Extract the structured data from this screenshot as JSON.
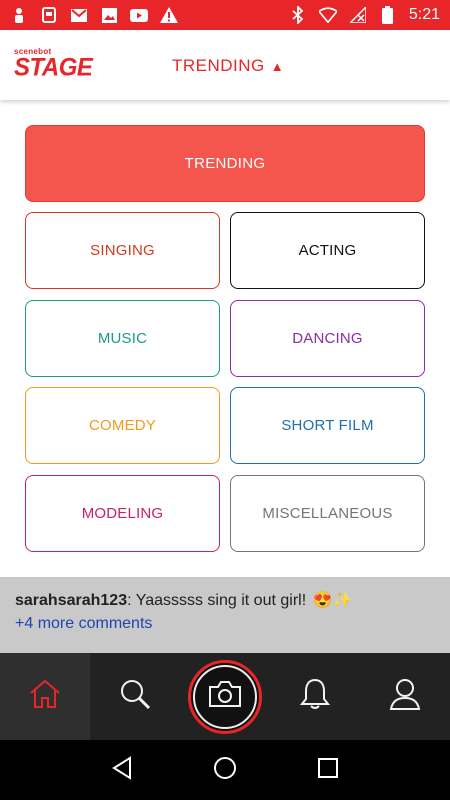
{
  "status_bar": {
    "time": "5:21",
    "left_icons": [
      "person-icon",
      "phone-message-icon",
      "gmail-icon",
      "image-icon",
      "youtube-icon",
      "warning-icon"
    ],
    "right_icons": [
      "bluetooth-icon",
      "wifi-icon",
      "no-signal-icon",
      "battery-icon"
    ]
  },
  "header": {
    "logo_small": "scenebot",
    "logo_big": "STAGE",
    "title": "TRENDING",
    "caret": "▲",
    "accent": "#e8262a"
  },
  "categories": {
    "trending": {
      "label": "TRENDING",
      "color": "#f4564d"
    },
    "items": [
      {
        "label": "SINGING",
        "color": "#d23a1f"
      },
      {
        "label": "ACTING",
        "color": "#111111"
      },
      {
        "label": "MUSIC",
        "color": "#1a9b8a"
      },
      {
        "label": "DANCING",
        "color": "#8a2ba8"
      },
      {
        "label": "COMEDY",
        "color": "#f09a20"
      },
      {
        "label": "SHORT FILM",
        "color": "#1d6fae"
      },
      {
        "label": "MODELING",
        "color": "#c8206a"
      },
      {
        "label": "MISCELLANEOUS",
        "color": "#757575"
      }
    ]
  },
  "comment": {
    "username": "sarahsarah123",
    "separator": ":",
    "text": " Yaasssss sing it out girl!",
    "emoji": "😍✨",
    "more": "+4 more comments"
  },
  "bottom_nav": {
    "items": [
      "home-icon",
      "search-icon",
      "camera-icon",
      "bell-icon",
      "profile-icon"
    ],
    "active": "home-icon"
  },
  "android_nav": [
    "back-icon",
    "home-circle-icon",
    "recents-icon"
  ]
}
